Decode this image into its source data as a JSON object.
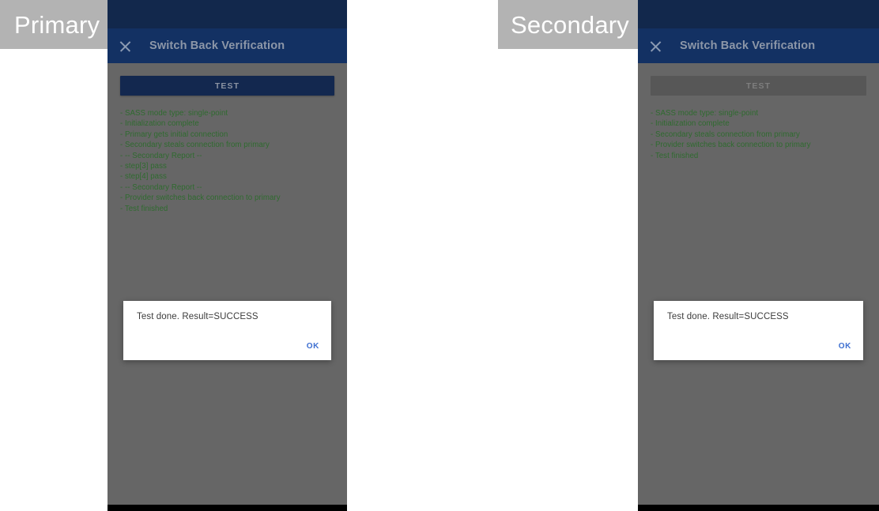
{
  "captions": {
    "primary": "Primary",
    "secondary": "Secondary"
  },
  "colors": {
    "caption_background": "#b3b3b3",
    "status_bar": "#12284c",
    "app_bar": "#133163",
    "content_background": "#666666",
    "test_button_enabled": "#13284f",
    "test_button_disabled": "#575757",
    "log_text": "#2f6b2f",
    "dialog_background": "#ffffff",
    "ok_link": "#3d6fd1",
    "nav_bar": "#000000"
  },
  "primary": {
    "app_bar": {
      "close_icon": "close-icon",
      "title": "Switch Back Verification"
    },
    "test_button": {
      "label": "TEST",
      "state": "enabled"
    },
    "log_lines": [
      "- SASS mode type: single-point",
      "- Initialization complete",
      "- Primary gets initial connection",
      "- Secondary steals connection from primary",
      "- -- Secondary Report --",
      "- step[3] pass",
      "- step[4] pass",
      "- -- Secondary Report --",
      "- Provider switches back connection to primary",
      "- Test finished"
    ],
    "dialog": {
      "message": "Test done. Result=SUCCESS",
      "ok_label": "OK"
    }
  },
  "secondary": {
    "app_bar": {
      "close_icon": "close-icon",
      "title": "Switch Back Verification"
    },
    "test_button": {
      "label": "TEST",
      "state": "disabled"
    },
    "log_lines": [
      "- SASS mode type: single-point",
      "- Initialization complete",
      "- Secondary steals connection from primary",
      "- Provider switches back connection to primary",
      "- Test finished"
    ],
    "dialog": {
      "message": "Test done. Result=SUCCESS",
      "ok_label": "OK"
    }
  }
}
